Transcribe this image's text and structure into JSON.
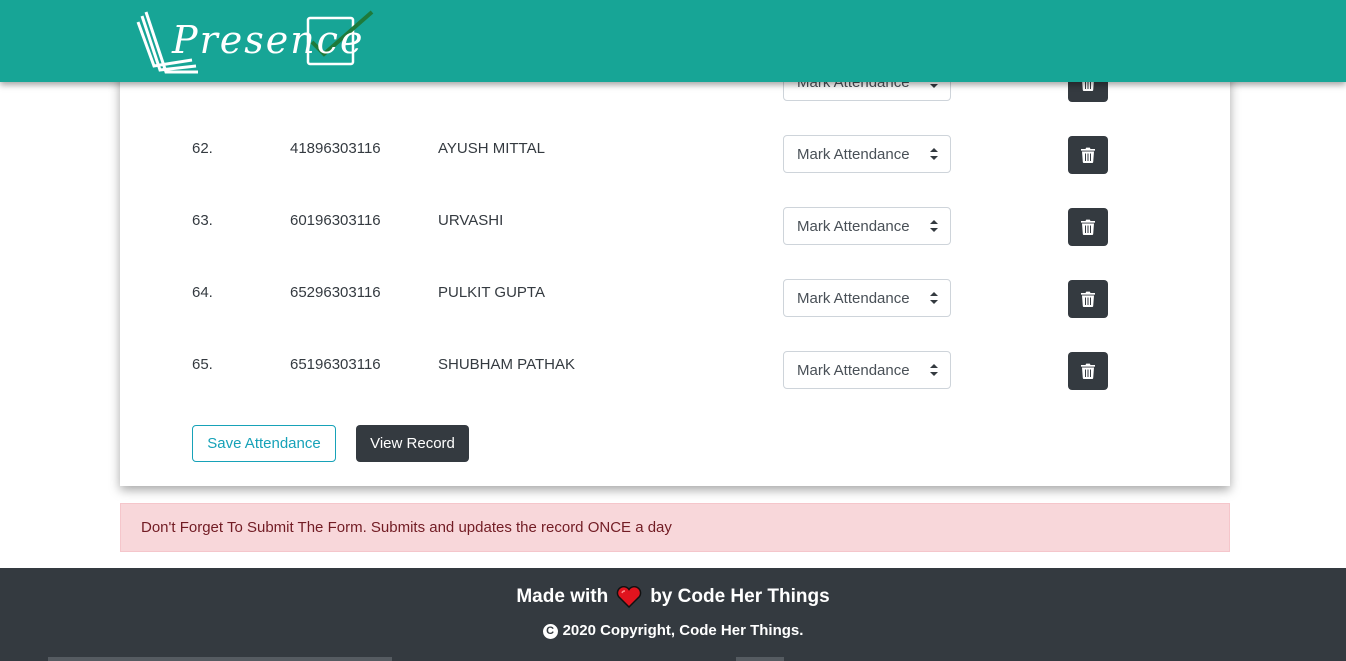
{
  "brand": {
    "name": "Presence"
  },
  "table": {
    "rows": [
      {
        "no": "",
        "id": "",
        "name": "",
        "select": "Mark Attendance"
      },
      {
        "no": "62.",
        "id": "41896303116",
        "name": "AYUSH MITTAL",
        "select": "Mark Attendance"
      },
      {
        "no": "63.",
        "id": "60196303116",
        "name": "URVASHI",
        "select": "Mark Attendance"
      },
      {
        "no": "64.",
        "id": "65296303116",
        "name": "PULKIT GUPTA",
        "select": "Mark Attendance"
      },
      {
        "no": "65.",
        "id": "65196303116",
        "name": "SHUBHAM PATHAK",
        "select": "Mark Attendance"
      }
    ]
  },
  "actions": {
    "save_label": "Save Attendance",
    "view_label": "View Record"
  },
  "alert": {
    "text": "Don't Forget To Submit The Form. Submits and updates the record ONCE a day"
  },
  "footer": {
    "made_with": "Made with",
    "by": "by Code Her Things",
    "copyright": "2020 Copyright, Code Her Things."
  },
  "icons": {
    "delete": "trash-icon",
    "copyright": "copyright-icon",
    "heart": "heart-icon"
  },
  "colors": {
    "header": "#17a596",
    "dark": "#343a40",
    "alert_bg": "#f8d7da",
    "alert_text": "#721c24",
    "outline_info": "#17a2b8"
  }
}
